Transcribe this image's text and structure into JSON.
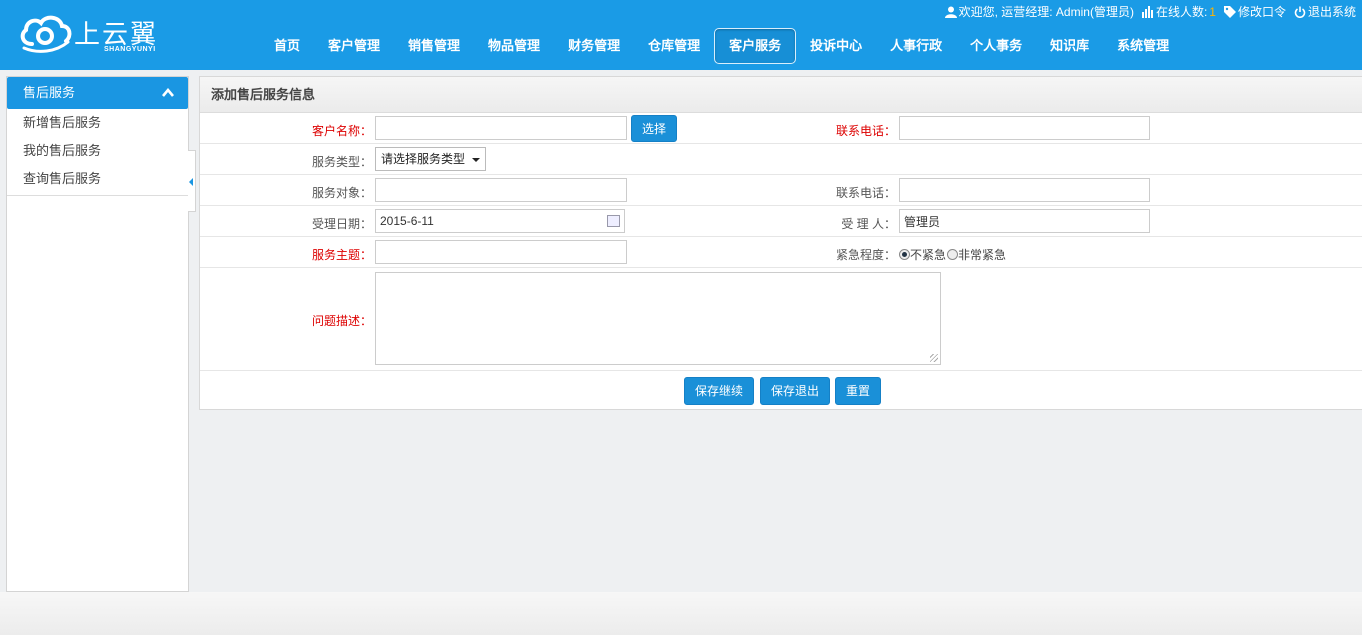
{
  "header": {
    "logo_text": "上云翼",
    "logo_sub": "SHANGYUNYI",
    "user_text": "欢迎您, 运营经理: Admin(管理员)",
    "online_label": "在线人数:",
    "online_count": "1",
    "change_pwd": "修改口令",
    "logout": "退出系统",
    "nav": [
      {
        "label": "首页"
      },
      {
        "label": "客户管理"
      },
      {
        "label": "销售管理"
      },
      {
        "label": "物品管理"
      },
      {
        "label": "财务管理"
      },
      {
        "label": "仓库管理"
      },
      {
        "label": "客户服务",
        "active": true
      },
      {
        "label": "投诉中心"
      },
      {
        "label": "人事行政"
      },
      {
        "label": "个人事务"
      },
      {
        "label": "知识库"
      },
      {
        "label": "系统管理"
      }
    ]
  },
  "sidebar": {
    "title": "售后服务",
    "items": [
      {
        "label": "新增售后服务"
      },
      {
        "label": "我的售后服务"
      },
      {
        "label": "查询售后服务"
      }
    ]
  },
  "form": {
    "title": "添加售后服务信息",
    "customer_label": "客户名称：",
    "customer_value": "",
    "select_button": "选择",
    "phone_label": "联系电话：",
    "phone_value": "",
    "service_type_label": "服务类型：",
    "service_type_value": "请选择服务类型",
    "target_label": "服务对象：",
    "target_value": "",
    "phone2_label": "联系电话：",
    "phone2_value": "",
    "date_label": "受理日期：",
    "date_value": "2015-6-11",
    "handler_label": "受 理 人：",
    "handler_value": "管理员",
    "subject_label": "服务主题：",
    "subject_value": "",
    "urgency_label": "紧急程度：",
    "urgency_options": [
      "不紧急",
      "非常紧急"
    ],
    "urgency_selected": "不紧急",
    "desc_label": "问题描述：",
    "desc_value": "",
    "buttons": {
      "save_continue": "保存继续",
      "save_exit": "保存退出",
      "reset": "重置"
    }
  }
}
